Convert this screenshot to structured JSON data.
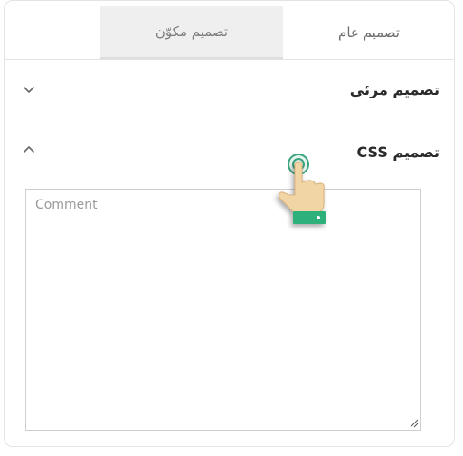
{
  "tabs": [
    {
      "label": "تصميم عام",
      "active": false
    },
    {
      "label": "تصميم مكوّن",
      "active": true
    }
  ],
  "sections": {
    "visual": {
      "title": "تصميم مرئي",
      "expanded": false
    },
    "css": {
      "title": "تصميم CSS",
      "expanded": true
    }
  },
  "comment_field": {
    "placeholder": "Comment",
    "value": ""
  },
  "icons": {
    "collapse": "chevron-down-icon",
    "expand": "chevron-up-icon",
    "pointer": "hand-pointer-icon"
  },
  "colors": {
    "active_tab_bg": "#efefef",
    "pointer_ring": "#3aa57e",
    "pointer_cuff": "#2db07a"
  }
}
